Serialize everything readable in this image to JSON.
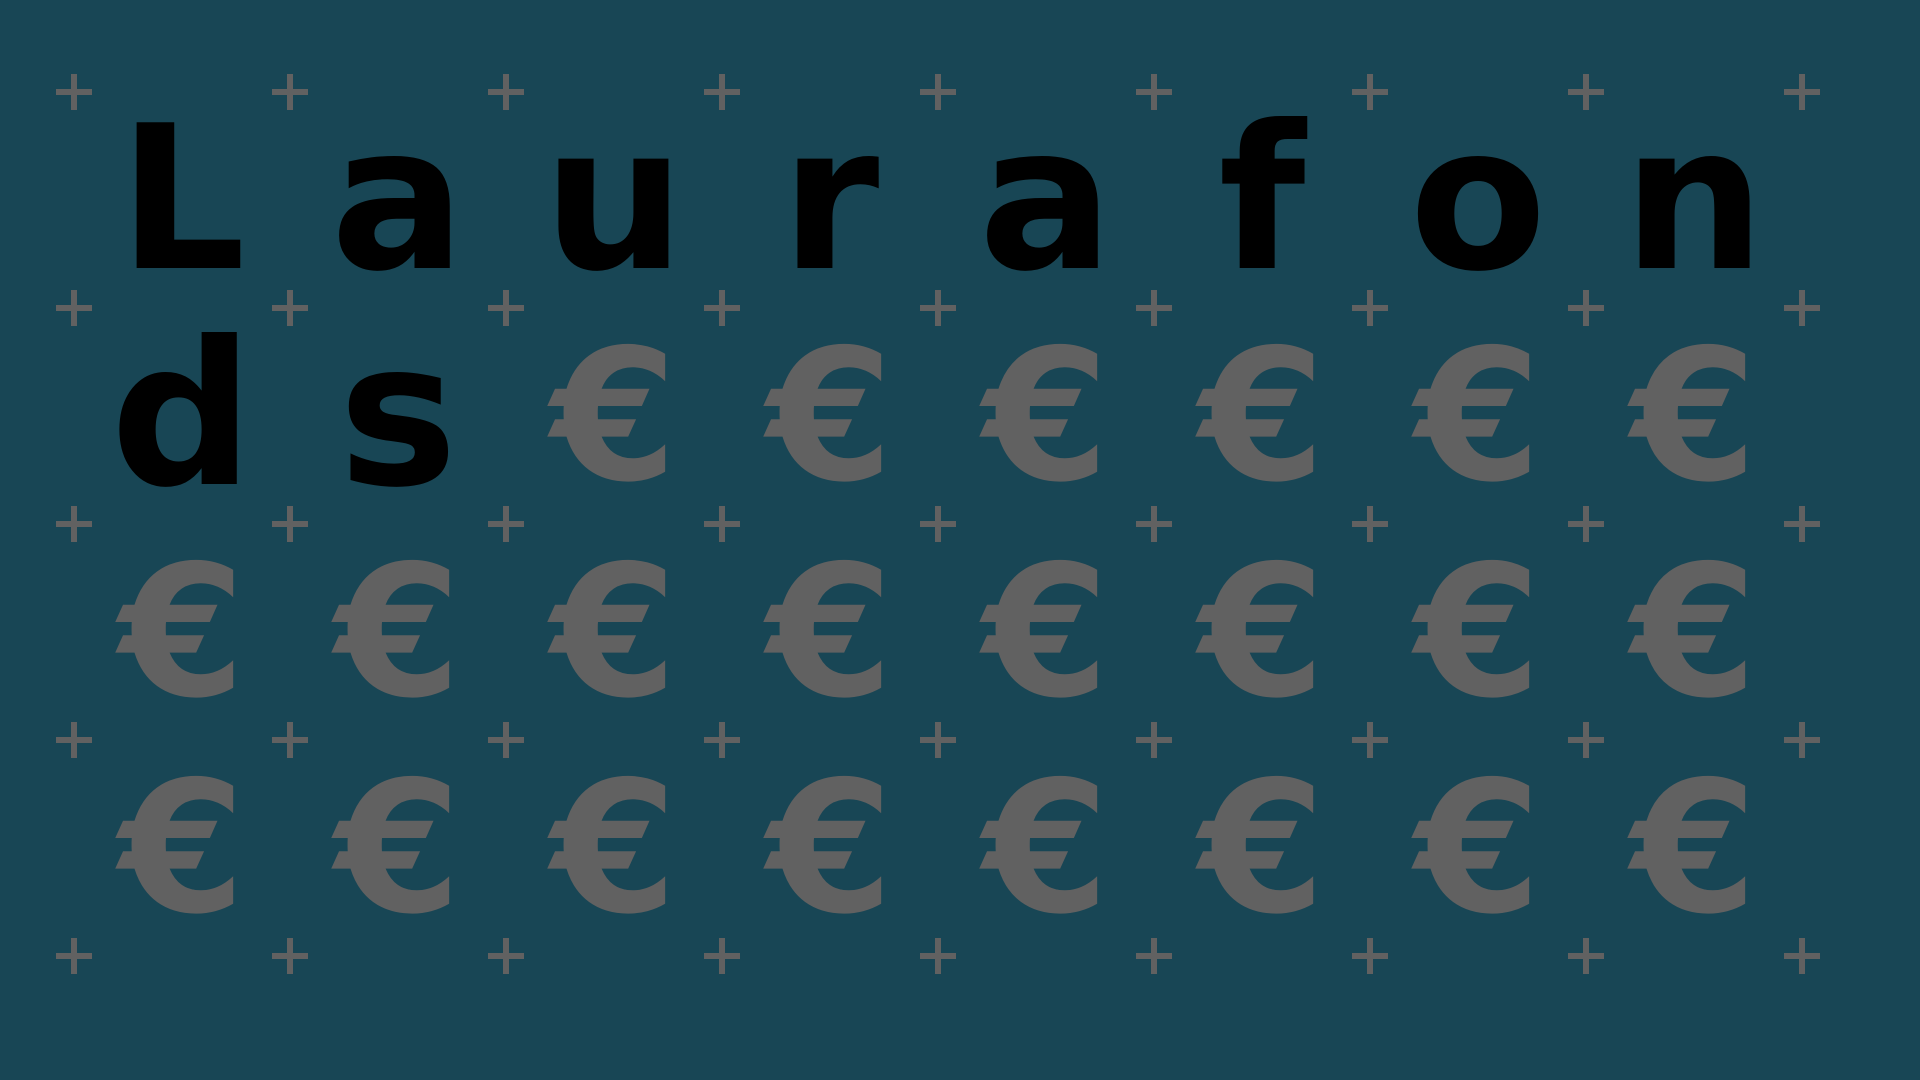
{
  "background_color": "#184655",
  "text_color": "#000000",
  "fill_color": "#616161",
  "plus_color": "#616161",
  "letters": [
    "L",
    "a",
    "u",
    "r",
    "a",
    "f",
    "o",
    "n",
    "d",
    "s"
  ],
  "fill_glyph": "€",
  "grid": {
    "columns": 8,
    "rows": 4
  },
  "marker_grid": {
    "columns": 9,
    "rows": 5
  }
}
